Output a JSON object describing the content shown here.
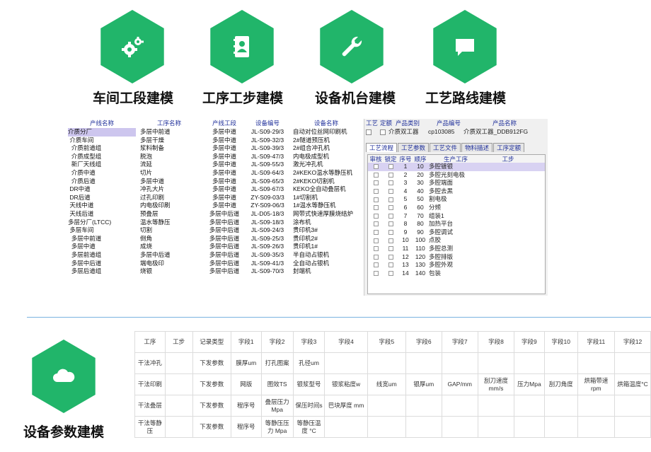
{
  "modules": [
    {
      "label": "车间工段建模",
      "icon": "gears-icon"
    },
    {
      "label": "工序工步建模",
      "icon": "address-book-icon"
    },
    {
      "label": "设备机台建模",
      "icon": "wrench-icon"
    },
    {
      "label": "工艺路线建模",
      "icon": "chat-bubble-icon"
    }
  ],
  "bottom_module": {
    "label": "设备参数建模",
    "icon": "cloud-icon"
  },
  "colors": {
    "accent": "#21b56a",
    "header_text": "#1f2f9a",
    "selected_row": "#cdc6ee",
    "divider": "#7ab3e0"
  },
  "left_table": {
    "headers": [
      "产线名称",
      "工序名称",
      "产线工段",
      "设备编号",
      "设备名称"
    ],
    "rows": [
      [
        "介质分厂",
        "多层中前道",
        "多层中道",
        "JL-S09-29/3",
        "自动对位丝网印刷机"
      ],
      [
        " 介质车间",
        "多层干燥",
        "多层中道",
        "JL-S09-32/3",
        "2#隧道预压机"
      ],
      [
        "  介质前道组",
        "浆料制备",
        "多层中道",
        "JL-S09-39/3",
        "2#组合冲孔机"
      ],
      [
        "  介质成型组",
        "脱泡",
        "多层中道",
        "JL-S09-47/3",
        "内电极成型机"
      ],
      [
        "  新厂天线组",
        "流延",
        "多层中道",
        "JL-S09-55/3",
        "激光冲孔机"
      ],
      [
        "  介质中道",
        "切片",
        "多层中道",
        "JL-S09-64/3",
        "2#KEKO温水等静压机"
      ],
      [
        "  介质后道",
        "多层中道",
        "多层中道",
        "JL-S09-65/3",
        "2#KEKO切割机"
      ],
      [
        " DR中道",
        "冲孔大片",
        "多层中道",
        "JL-S09-67/3",
        "KEKO全自动叠层机"
      ],
      [
        " DR后道",
        "过孔印刷",
        "多层中道",
        "ZY-S09-03/3",
        "1#切割机"
      ],
      [
        " 天线中道",
        "内电极印刷",
        "多层中道",
        "ZY-S09-06/3",
        "1#温水等静压机"
      ],
      [
        " 天线后道",
        "预叠层",
        "多层中后道",
        "JL-D05-18/3",
        "网带式快速厚膜烧结炉"
      ],
      [
        "多层分厂(LTCC)",
        "温水等静压",
        "多层中后道",
        "JL-S09-18/3",
        "涂布机"
      ],
      [
        " 多层车间",
        "切割",
        "多层中后道",
        "JL-S09-24/3",
        "贵印机3#"
      ],
      [
        "  多层中前道",
        "倒角",
        "多层中后道",
        "JL-S09-25/3",
        "贵印机2#"
      ],
      [
        "  多层中道",
        "成烧",
        "多层中后道",
        "JL-S09-26/3",
        "贵印机1#"
      ],
      [
        "  多层前道组",
        "多层中后道",
        "多层中后道",
        "JL-S09-35/3",
        "半自动占银机"
      ],
      [
        "  多层中后道",
        "端电极印",
        "多层中后道",
        "JL-S09-41/3",
        "全自动占银机"
      ],
      [
        "  多层后道组",
        "烧银",
        "多层中后道",
        "JL-S09-70/3",
        "封端机"
      ]
    ]
  },
  "right_panel": {
    "top_headers": [
      "工艺",
      "定额",
      "产品类别",
      "产品编号",
      "产品名称"
    ],
    "top_values": {
      "category": "介质双工器",
      "code": "cp103085",
      "name": "介质双工器_DDB912FG"
    },
    "tabs": [
      "工艺流程",
      "工艺参数",
      "工艺文件",
      "物料描述",
      "工序定额"
    ],
    "grid_headers": [
      "审核",
      "锁定",
      "序号",
      "顺序",
      "生产工序",
      "工步"
    ],
    "grid_rows": [
      [
        "1",
        "10",
        "多腔镀银"
      ],
      [
        "2",
        "20",
        "多腔光刻电极"
      ],
      [
        "3",
        "30",
        "多腔端面"
      ],
      [
        "4",
        "40",
        "多腔去黑"
      ],
      [
        "5",
        "50",
        "割电极"
      ],
      [
        "6",
        "60",
        "分频"
      ],
      [
        "7",
        "70",
        "组装1"
      ],
      [
        "8",
        "80",
        "加热平台"
      ],
      [
        "9",
        "90",
        "多腔调试"
      ],
      [
        "10",
        "100",
        "点胶"
      ],
      [
        "11",
        "110",
        "多腔总测"
      ],
      [
        "12",
        "120",
        "多腔排版"
      ],
      [
        "13",
        "130",
        "多腔外观"
      ],
      [
        "14",
        "140",
        "包装"
      ]
    ]
  },
  "param_table": {
    "headers": [
      "工序",
      "工步",
      "记录类型",
      "字段1",
      "字段2",
      "字段3",
      "字段4",
      "字段5",
      "字段6",
      "字段7",
      "字段8",
      "字段9",
      "字段10",
      "字段11",
      "字段12"
    ],
    "rows": [
      [
        "干法冲孔",
        "",
        "下发参数",
        "膜厚um",
        "打孔图案",
        "孔径um",
        "",
        "",
        "",
        "",
        "",
        "",
        "",
        "",
        ""
      ],
      [
        "干法印刷",
        "",
        "下发参数",
        "网版",
        "图效TS",
        "银浆型号",
        "银浆粘度w",
        "线宽um",
        "银厚um",
        "GAP/mm",
        "刮刀速度 mm/s",
        "压力Mpa",
        "刮刀角度",
        "烘箱带速 rpm",
        "烘箱温度°C"
      ],
      [
        "干法叠层",
        "",
        "下发参数",
        "程序号",
        "叠层压力 Mpa",
        "保压时间s",
        "巴块厚度 mm",
        "",
        "",
        "",
        "",
        "",
        "",
        "",
        ""
      ],
      [
        "干法等静压",
        "",
        "下发参数",
        "程序号",
        "等静压压力 Mpa",
        "等静压温度 °C",
        "",
        "",
        "",
        "",
        "",
        "",
        "",
        "",
        ""
      ]
    ]
  }
}
